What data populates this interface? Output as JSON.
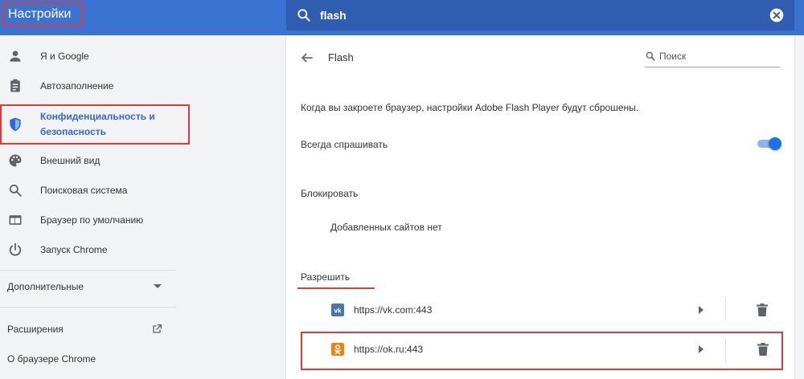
{
  "header": {
    "title": "Настройки",
    "search_value": "flash"
  },
  "sidebar": {
    "items": [
      {
        "label": "Я и Google",
        "icon": "person-icon"
      },
      {
        "label": "Автозаполнение",
        "icon": "clipboard-icon"
      },
      {
        "label": "Конфиденциальность и безопасность",
        "icon": "shield-icon"
      },
      {
        "label": "Внешний вид",
        "icon": "palette-icon"
      },
      {
        "label": "Поисковая система",
        "icon": "search-icon"
      },
      {
        "label": "Браузер по умолчанию",
        "icon": "browser-icon"
      },
      {
        "label": "Запуск Chrome",
        "icon": "power-icon"
      }
    ],
    "advanced_label": "Дополнительные",
    "extensions_label": "Расширения",
    "about_label": "О браузере Chrome"
  },
  "main": {
    "title": "Flash",
    "search_placeholder": "Поиск",
    "info_text": "Когда вы закроете браузер, настройки Adobe Flash Player будут сброшены.",
    "ask_label": "Всегда спрашивать",
    "ask_enabled": true,
    "block_heading": "Блокировать",
    "block_empty": "Добавленных сайтов нет",
    "allow_heading": "Разрешить",
    "allowed_sites": [
      {
        "url": "https://vk.com:443",
        "icon": "vk-icon",
        "color": "#4a76a8"
      },
      {
        "url": "https://ok.ru:443",
        "icon": "ok-icon",
        "color": "#ee8208"
      }
    ]
  },
  "colors": {
    "header": "#3b73d2",
    "accent": "#1a73e8",
    "highlight": "#e53935"
  }
}
